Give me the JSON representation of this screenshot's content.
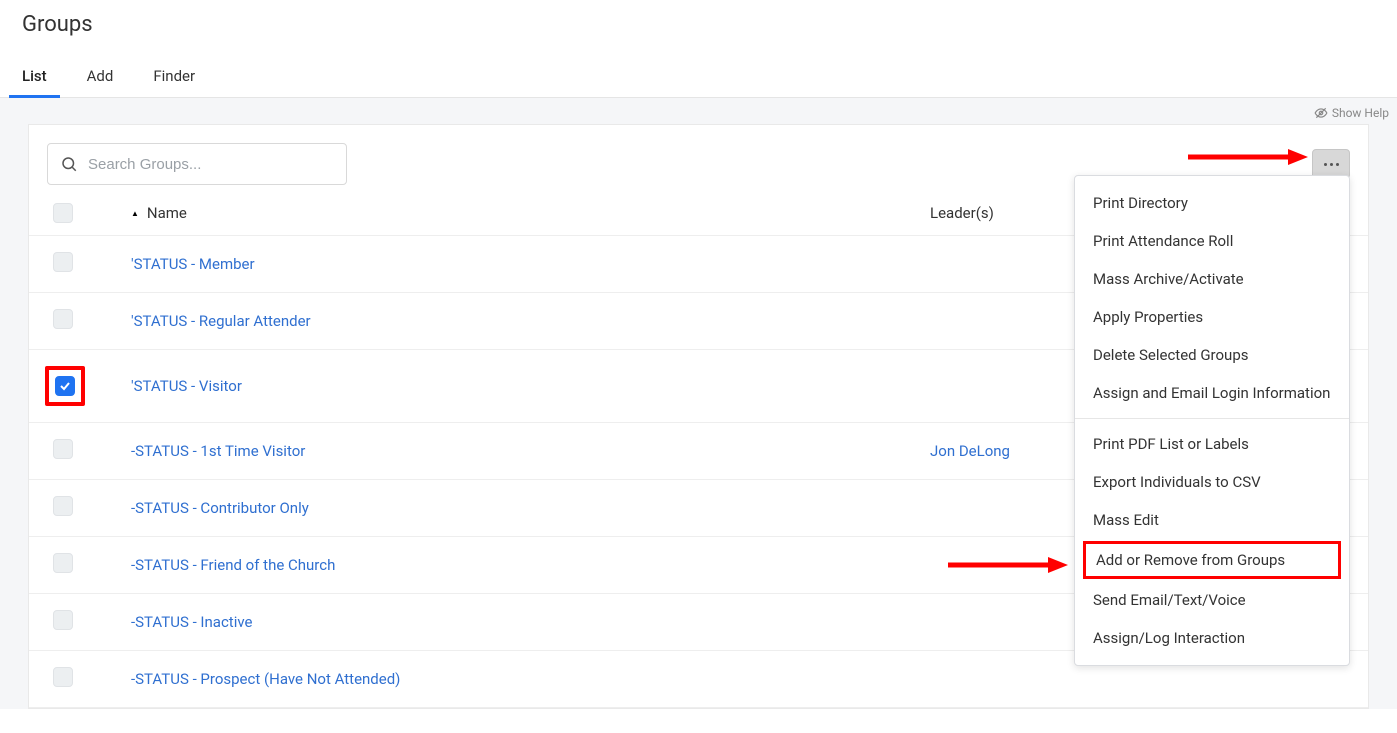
{
  "page_title": "Groups",
  "tabs": [
    {
      "label": "List",
      "active": true
    },
    {
      "label": "Add",
      "active": false
    },
    {
      "label": "Finder",
      "active": false
    }
  ],
  "show_help_label": "Show Help",
  "search": {
    "placeholder": "Search Groups..."
  },
  "table": {
    "columns": {
      "name": "Name",
      "leaders": "Leader(s)"
    },
    "rows": [
      {
        "checked": false,
        "highlight": false,
        "name": "'STATUS - Member",
        "leaders": ""
      },
      {
        "checked": false,
        "highlight": false,
        "name": "'STATUS - Regular Attender",
        "leaders": ""
      },
      {
        "checked": true,
        "highlight": true,
        "name": "'STATUS - Visitor",
        "leaders": ""
      },
      {
        "checked": false,
        "highlight": false,
        "name": "-STATUS - 1st Time Visitor",
        "leaders": "Jon DeLong"
      },
      {
        "checked": false,
        "highlight": false,
        "name": "-STATUS - Contributor Only",
        "leaders": ""
      },
      {
        "checked": false,
        "highlight": false,
        "name": "-STATUS - Friend of the Church",
        "leaders": ""
      },
      {
        "checked": false,
        "highlight": false,
        "name": "-STATUS - Inactive",
        "leaders": ""
      },
      {
        "checked": false,
        "highlight": false,
        "name": "-STATUS - Prospect (Have Not Attended)",
        "leaders": ""
      }
    ]
  },
  "dropdown": {
    "sections": [
      {
        "items": [
          {
            "label": "Print Directory",
            "highlight": false
          },
          {
            "label": "Print Attendance Roll",
            "highlight": false
          },
          {
            "label": "Mass Archive/Activate",
            "highlight": false
          },
          {
            "label": "Apply Properties",
            "highlight": false
          },
          {
            "label": "Delete Selected Groups",
            "highlight": false
          },
          {
            "label": "Assign and Email Login Information",
            "highlight": false
          }
        ]
      },
      {
        "items": [
          {
            "label": "Print PDF List or Labels",
            "highlight": false
          },
          {
            "label": "Export Individuals to CSV",
            "highlight": false
          },
          {
            "label": "Mass Edit",
            "highlight": false
          },
          {
            "label": "Add or Remove from Groups",
            "highlight": true
          },
          {
            "label": "Send Email/Text/Voice",
            "highlight": false
          },
          {
            "label": "Assign/Log Interaction",
            "highlight": false
          }
        ]
      }
    ]
  },
  "annotation_arrows": {
    "top": true,
    "middle": true
  }
}
